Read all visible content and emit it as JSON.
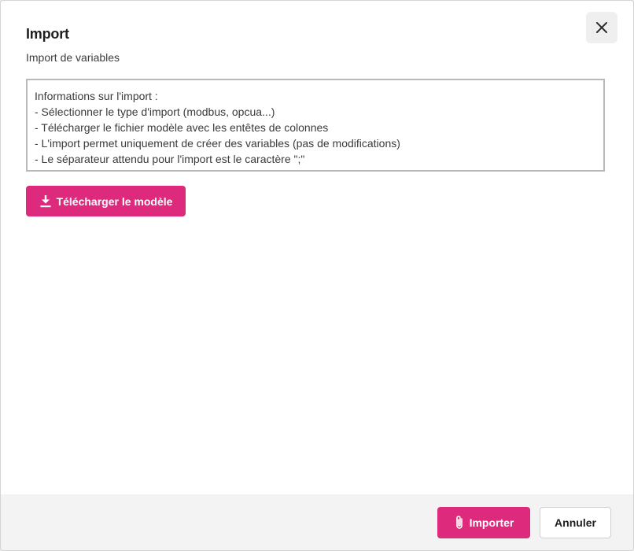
{
  "dialog": {
    "title": "Import",
    "subtitle": "Import de variables",
    "close_icon": "close-icon"
  },
  "info": {
    "lines": [
      "Informations sur l'import :",
      "- Sélectionner le type d'import (modbus, opcua...)",
      "- Télécharger le fichier modèle avec les entêtes de colonnes",
      "- L'import permet uniquement de créer des variables (pas de modifications)",
      "- Le séparateur attendu pour l'import est le caractère \";\""
    ]
  },
  "download": {
    "label": "Télécharger le modèle",
    "icon": "download-icon"
  },
  "footer": {
    "import_label": "Importer",
    "import_icon": "paperclip-icon",
    "cancel_label": "Annuler"
  },
  "colors": {
    "accent": "#de2a7c",
    "footer_bg": "#f3f3f3"
  }
}
